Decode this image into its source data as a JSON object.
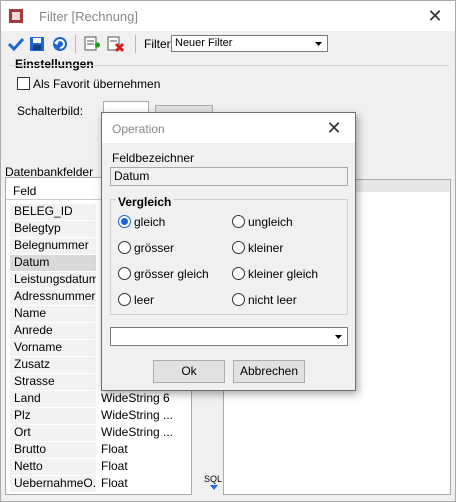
{
  "window": {
    "title": "Filter  [Rechnung]",
    "close": "✕"
  },
  "toolbar": {
    "icons": [
      "check-icon",
      "save-icon",
      "undo-icon",
      "add-filter-icon",
      "delete-filter-icon"
    ],
    "filter_label": "Filter",
    "filter_value": "Neuer Filter"
  },
  "settings": {
    "group_title": "Einstellungen",
    "favorite_label": "Als Favorit übernehmen",
    "favorite_checked": false,
    "button_image_label": "Schalterbild:"
  },
  "db_fields": {
    "label": "Datenbankfelder",
    "column_header": "Feld",
    "rows": [
      {
        "name": "BELEG_ID",
        "type": "",
        "size": ""
      },
      {
        "name": "Belegtyp",
        "type": "",
        "size": ""
      },
      {
        "name": "Belegnummer",
        "type": "",
        "size": ""
      },
      {
        "name": "Datum",
        "type": "",
        "size": ""
      },
      {
        "name": "Leistungsdatum",
        "type": "",
        "size": ""
      },
      {
        "name": "Adressnummer",
        "type": "",
        "size": ""
      },
      {
        "name": "Name",
        "type": "",
        "size": ""
      },
      {
        "name": "Anrede",
        "type": "",
        "size": ""
      },
      {
        "name": "Vorname",
        "type": "",
        "size": ""
      },
      {
        "name": "Zusatz",
        "type": "",
        "size": ""
      },
      {
        "name": "Strasse",
        "type": "",
        "size": ""
      },
      {
        "name": "Land",
        "type": "WideString",
        "size": "6"
      },
      {
        "name": "Plz",
        "type": "WideString",
        "size": "..."
      },
      {
        "name": "Ort",
        "type": "WideString",
        "size": "..."
      },
      {
        "name": "Brutto",
        "type": "Float",
        "size": ""
      },
      {
        "name": "Netto",
        "type": "Float",
        "size": ""
      },
      {
        "name": "UebernahmeO...",
        "type": "Float",
        "size": ""
      }
    ]
  },
  "sql_label": "SQL",
  "dialog": {
    "title": "Operation",
    "close": "✕",
    "field_label": "Feldbezeichner",
    "field_value": "Datum",
    "compare_title": "Vergleich",
    "options": [
      {
        "label": "gleich",
        "selected": true
      },
      {
        "label": "ungleich",
        "selected": false
      },
      {
        "label": "grösser",
        "selected": false
      },
      {
        "label": "kleiner",
        "selected": false
      },
      {
        "label": "grösser gleich",
        "selected": false
      },
      {
        "label": "kleiner gleich",
        "selected": false
      },
      {
        "label": "leer",
        "selected": false
      },
      {
        "label": "nicht leer",
        "selected": false
      }
    ],
    "ok_label": "Ok",
    "cancel_label": "Abbrechen"
  },
  "colors": {
    "accent": "#1f66d1",
    "selected_row": "#d9d9d9"
  }
}
